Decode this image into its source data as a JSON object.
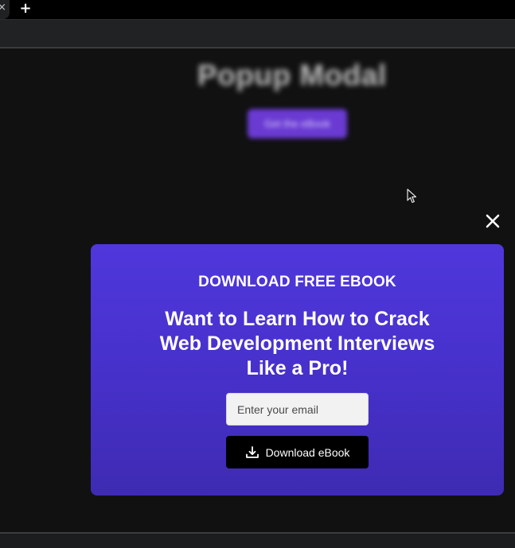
{
  "browser": {
    "tab_close_glyph": "×",
    "new_tab_glyph": "+"
  },
  "page": {
    "background_title": "Popup Modal",
    "background_button_label": "Get the eBook"
  },
  "modal": {
    "close_glyph": "✕",
    "kicker": "DOWNLOAD FREE EBOOK",
    "headline_lines": [
      "Want to Learn How to Crack",
      "Web Development Interviews",
      "Like a Pro!"
    ],
    "email_placeholder": "Enter your email",
    "email_value": "",
    "download_label": "Download eBook",
    "download_icon": "download-icon"
  },
  "colors": {
    "modal_top": "#4f37dc",
    "modal_bottom": "#3e2bb2",
    "button_bg": "#000000",
    "page_bg": "#111112",
    "bg_button": "#6a3ad2"
  }
}
